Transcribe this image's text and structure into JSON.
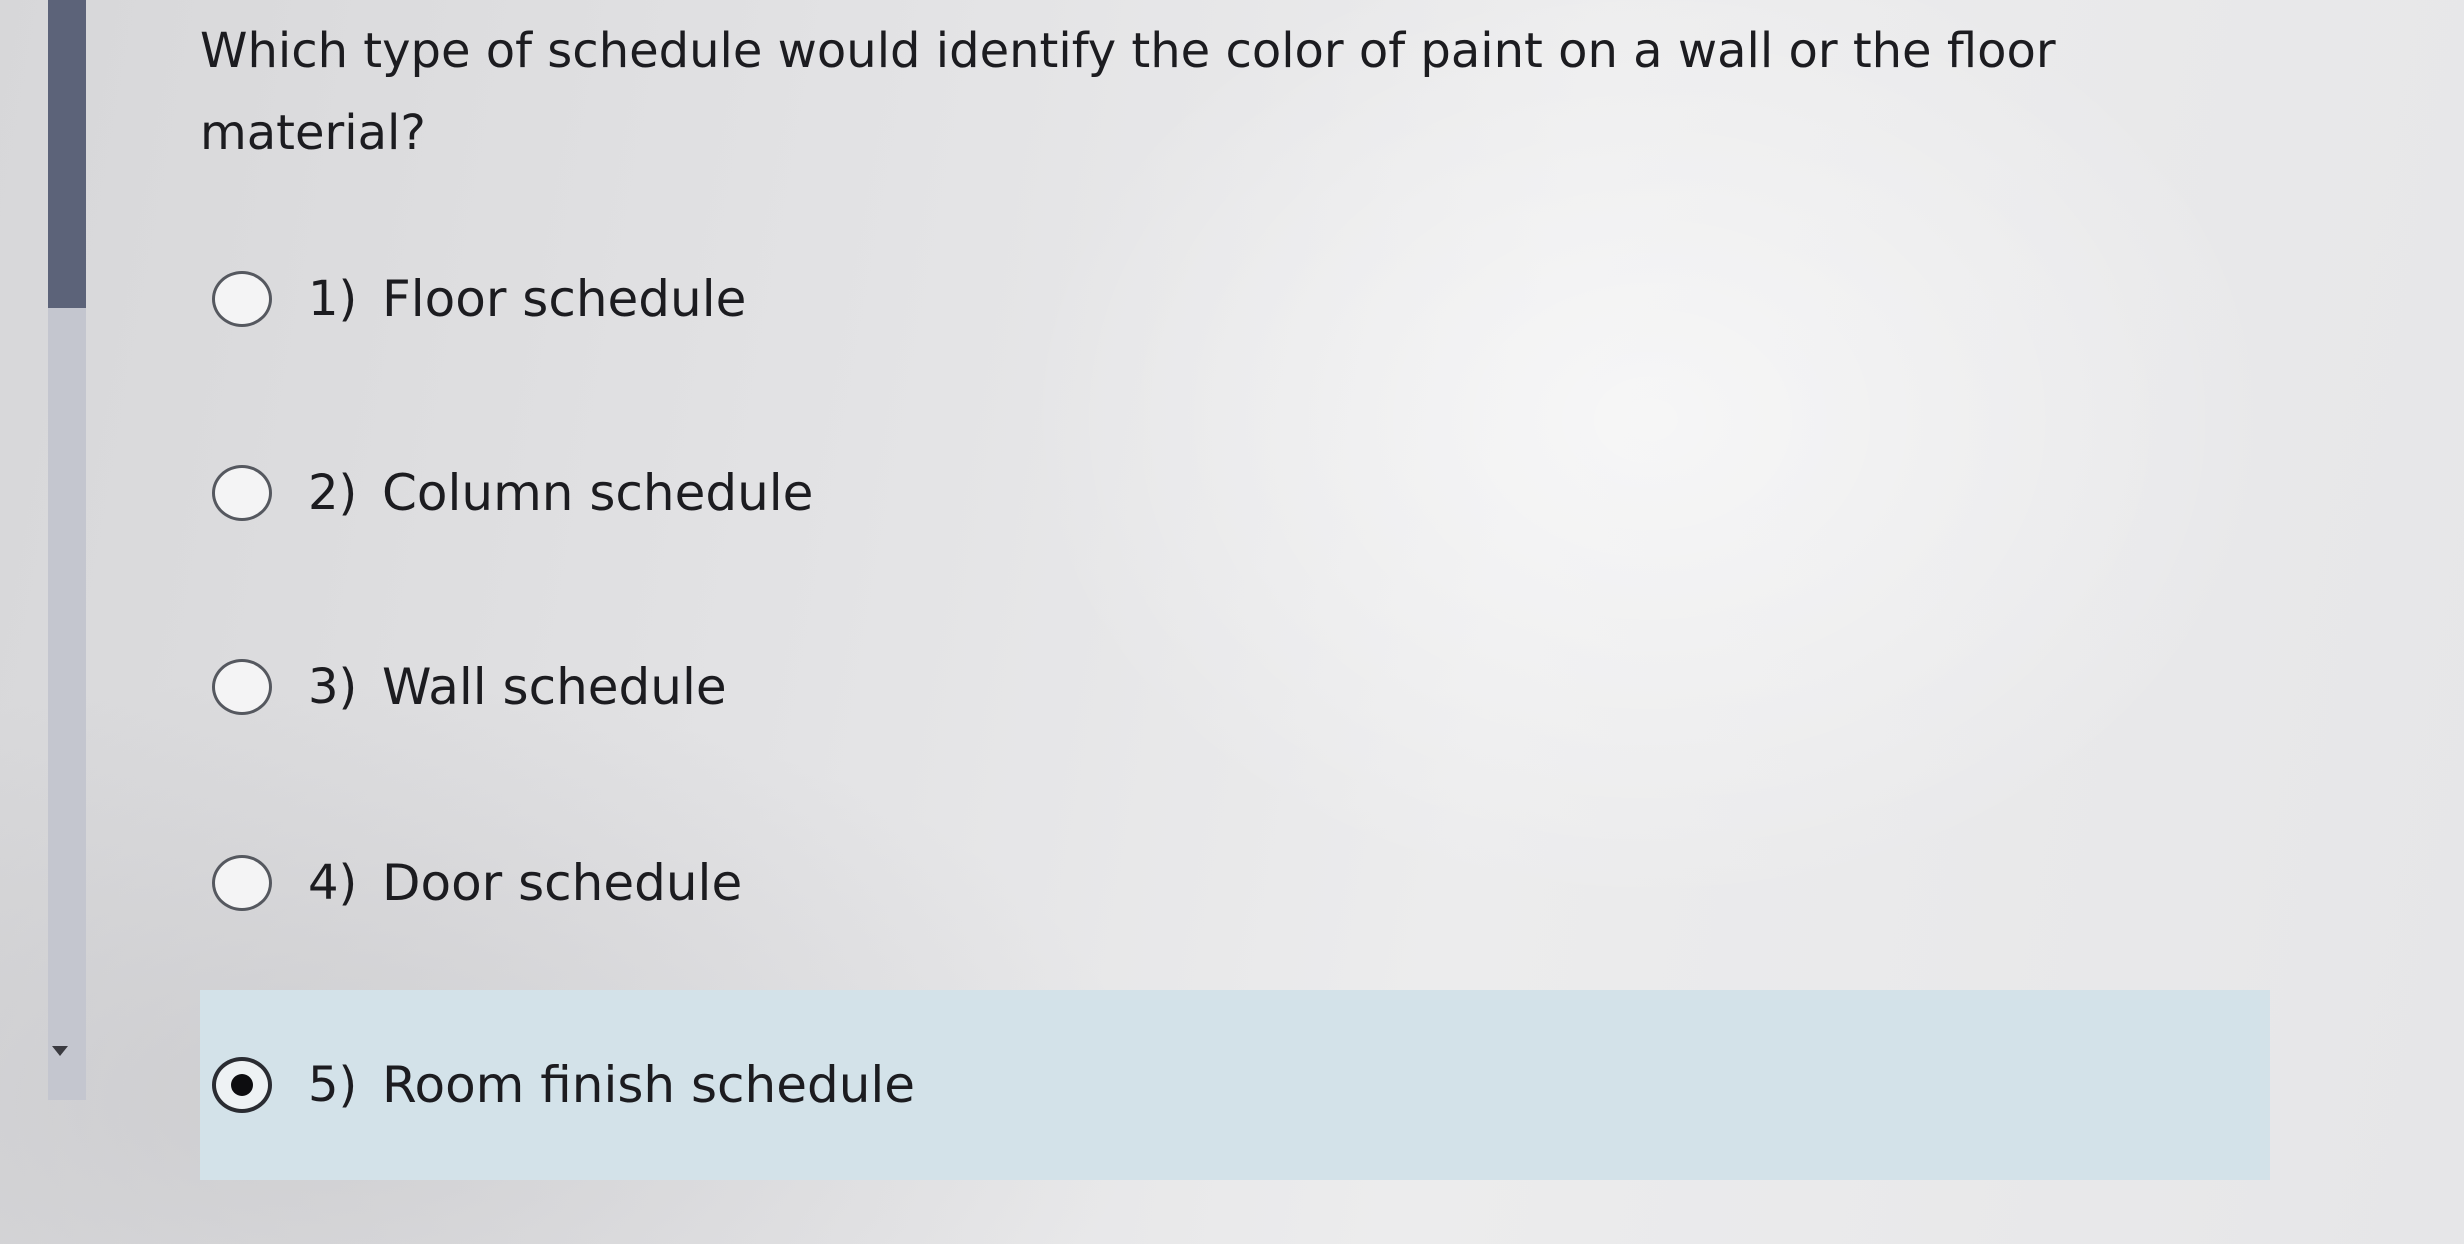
{
  "question": {
    "text": "Which type of schedule would identify the color of paint on a wall or the floor material?"
  },
  "options": [
    {
      "number": "1)",
      "label": "Floor schedule",
      "selected": false
    },
    {
      "number": "2)",
      "label": "Column schedule",
      "selected": false
    },
    {
      "number": "3)",
      "label": "Wall schedule",
      "selected": false
    },
    {
      "number": "4)",
      "label": "Door schedule",
      "selected": false
    },
    {
      "number": "5)",
      "label": "Room finish schedule",
      "selected": true
    }
  ],
  "icons": {
    "scroll_down": "caret-down-icon",
    "radio": "radio-button-icon"
  },
  "colors": {
    "selected_background": "#d3e2e9",
    "scrollbar_thumb": "#5c6379",
    "scrollbar_track": "#c4c6cf",
    "text": "#1c1c20"
  }
}
